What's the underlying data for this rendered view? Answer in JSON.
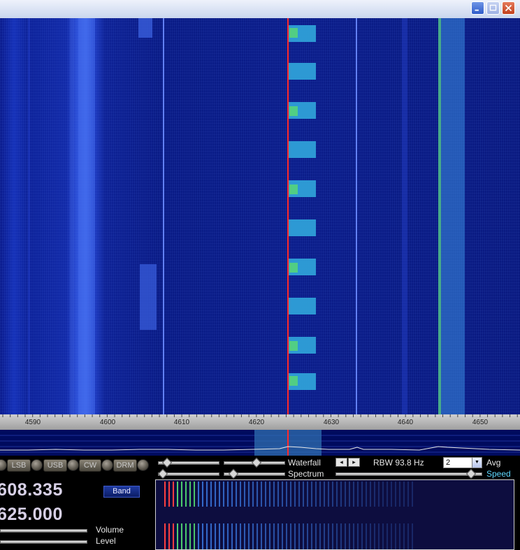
{
  "window": {
    "controls": [
      "minimize-icon",
      "maximize-icon",
      "close-icon"
    ]
  },
  "frequency_scale": {
    "labels": [
      "4590",
      "4600",
      "4610",
      "4620",
      "4630",
      "4640",
      "4650"
    ]
  },
  "modes": [
    "LSB",
    "USB",
    "CW",
    "DRM"
  ],
  "readout": {
    "freq1": "608.335",
    "freq2": "625.000"
  },
  "buttons": {
    "band": "Band"
  },
  "sliders": {
    "volume": "Volume",
    "level": "Level"
  },
  "display_controls": {
    "waterfall": "Waterfall",
    "spectrum": "Spectrum",
    "rbw": "RBW 93.8 Hz",
    "avg_value": "2",
    "avg": "Avg",
    "speed": "Speed"
  },
  "colors": {
    "marker": "#ff2a2a",
    "waterfall_bg": "#0b1d8a",
    "speed_label": "#5fd8ff"
  }
}
